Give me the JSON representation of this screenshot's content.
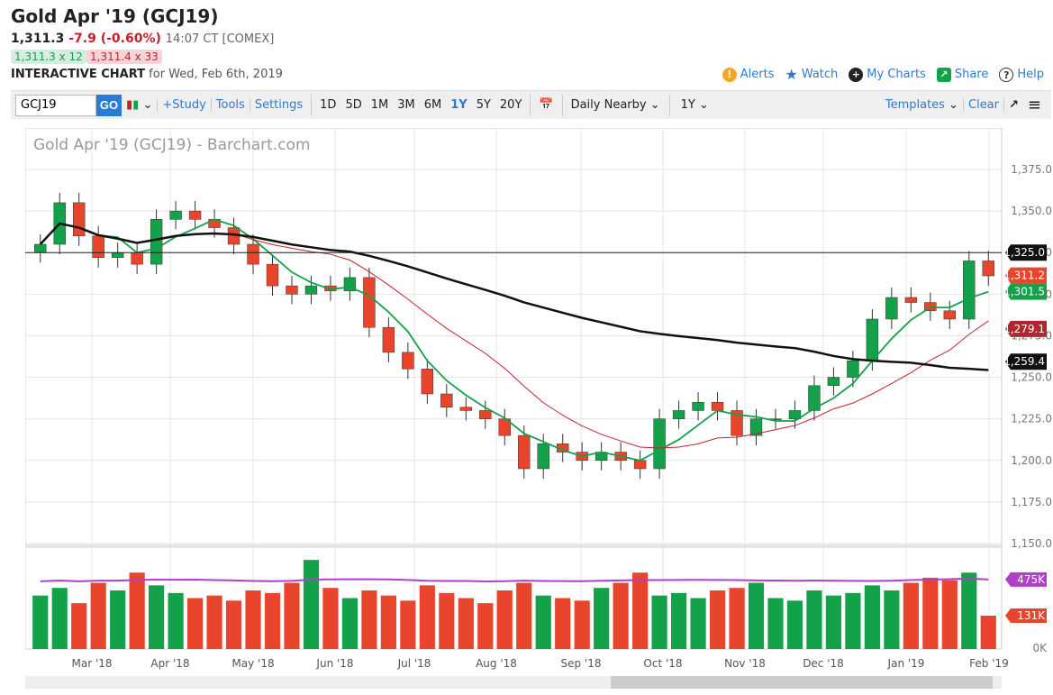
{
  "header": {
    "title": "Gold Apr '19 (GCJ19)",
    "last": "1,311.3",
    "change": "-7.9 (-0.60%)",
    "time": "14:07 CT [COMEX]",
    "bid": "1,311.3 x 12",
    "ask": "1,311.4 x 33",
    "chart_label": "INTERACTIVE CHART",
    "chart_date": "for Wed, Feb 6th, 2019"
  },
  "top_links": [
    "Alerts",
    "Watch",
    "My Charts",
    "Share",
    "Help"
  ],
  "toolbar": {
    "symbol": "GCJ19",
    "go": "GO",
    "study": "+Study",
    "tools": "Tools",
    "settings": "Settings",
    "periods": [
      "1D",
      "5D",
      "1M",
      "3M",
      "6M",
      "1Y",
      "5Y",
      "20Y"
    ],
    "active_period": "1Y",
    "interval": "Daily Nearby",
    "range": "1Y",
    "templates": "Templates",
    "clear": "Clear"
  },
  "chart_data": {
    "type": "candlestick",
    "title": "Gold Apr '19 (GCJ19) - Barchart.com",
    "y_ticks": [
      "1,375.0",
      "1,350.0",
      "1,325.0",
      "1,300.0",
      "1,275.0",
      "1,250.0",
      "1,225.0",
      "1,200.0",
      "1,175.0",
      "1,150.0"
    ],
    "ylim": [
      1150,
      1375
    ],
    "x_labels": [
      "Mar '18",
      "Apr '18",
      "May '18",
      "Jun '18",
      "Jul '18",
      "Aug '18",
      "Sep '18",
      "Oct '18",
      "Nov '18",
      "Dec '18",
      "Jan '19",
      "Feb '19"
    ],
    "closes": [
      1330,
      1355,
      1335,
      1322,
      1325,
      1318,
      1345,
      1350,
      1345,
      1340,
      1330,
      1318,
      1305,
      1300,
      1305,
      1302,
      1310,
      1280,
      1265,
      1255,
      1240,
      1232,
      1230,
      1225,
      1215,
      1195,
      1210,
      1205,
      1200,
      1205,
      1200,
      1195,
      1225,
      1230,
      1235,
      1230,
      1215,
      1225,
      1225,
      1230,
      1245,
      1250,
      1260,
      1285,
      1298,
      1295,
      1290,
      1285,
      1320,
      1311
    ],
    "volume": [
      210,
      240,
      180,
      260,
      230,
      300,
      250,
      220,
      200,
      210,
      190,
      230,
      220,
      260,
      350,
      240,
      200,
      230,
      210,
      190,
      250,
      220,
      200,
      180,
      230,
      260,
      210,
      200,
      190,
      240,
      260,
      300,
      210,
      220,
      200,
      230,
      240,
      260,
      200,
      190,
      230,
      210,
      220,
      250,
      230,
      260,
      280,
      270,
      300,
      131
    ],
    "horizontal_line": 1325.0,
    "price_tags": [
      {
        "label": "1,325.0",
        "value": 1325.0,
        "color": "#111111"
      },
      {
        "label": "1,311.2",
        "value": 1311.2,
        "color": "#e8452c"
      },
      {
        "label": "1,301.5",
        "value": 1301.5,
        "color": "#13a14a"
      },
      {
        "label": "1,279.1",
        "value": 1279.1,
        "color": "#b3262e"
      },
      {
        "label": "1,259.4",
        "value": 1259.4,
        "color": "#111111"
      }
    ],
    "volume_tags": [
      {
        "label": "475K",
        "color": "#b040c8"
      },
      {
        "label": "131K",
        "color": "#e8452c"
      }
    ],
    "volume_zero": "0K",
    "colors": {
      "up": "#13a14a",
      "down": "#e8452c",
      "ma20": "#13a14a",
      "ma50": "#c8202a",
      "ma200": "#111111",
      "vol_ma": "#b040c8"
    }
  }
}
